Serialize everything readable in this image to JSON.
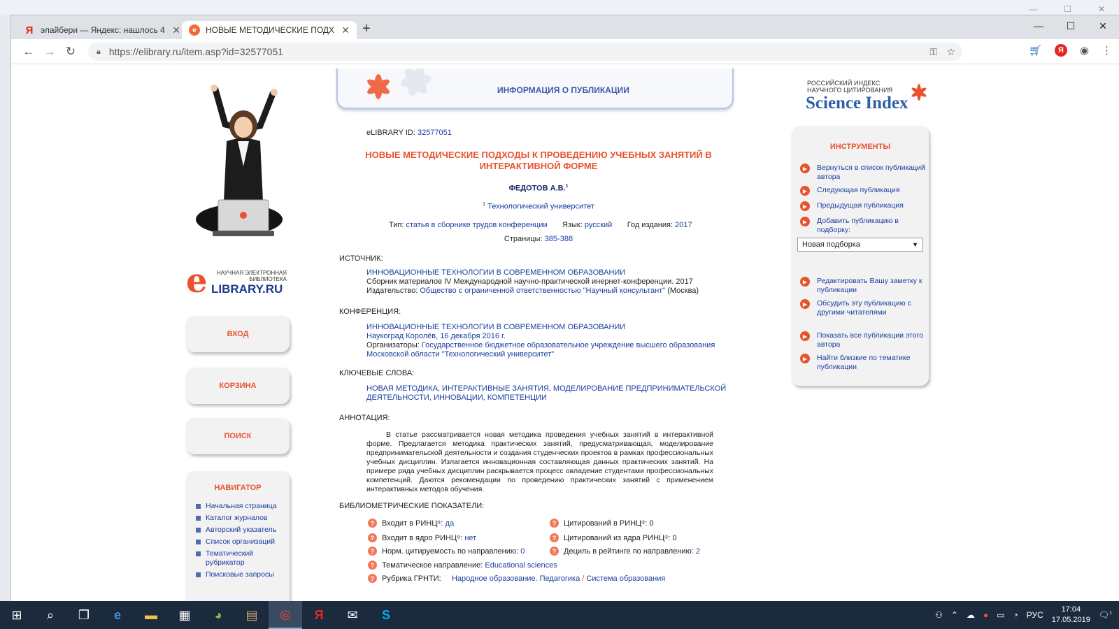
{
  "browser": {
    "tabs": [
      {
        "label": "элайбери — Яндекс: нашлось 4",
        "favicon": "yandex-icon"
      },
      {
        "label": "НОВЫЕ МЕТОДИЧЕСКИЕ ПОДХ",
        "favicon": "elibrary-icon"
      }
    ],
    "new_tab": "+",
    "url": "https://elibrary.ru/item.asp?id=32577051",
    "ya_ext": "Я",
    "yandex_fav": "Я",
    "elib_fav": "e"
  },
  "left": {
    "logo_small": "НАУЧНАЯ ЭЛЕКТРОННАЯ БИБЛИОТЕКА",
    "logo_e": "e",
    "logo_big": "LIBRARY.RU",
    "buttons": [
      "ВХОД",
      "КОРЗИНА",
      "ПОИСК"
    ],
    "navigator_title": "НАВИГАТОР",
    "navigator_items": [
      "Начальная страница",
      "Каталог журналов",
      "Авторский указатель",
      "Список организаций",
      "Тематический рубрикатор",
      "Поисковые запросы"
    ]
  },
  "center": {
    "banner_title": "ИНФОРМАЦИЯ О ПУБЛИКАЦИИ",
    "id_label": "eLIBRARY ID:",
    "id_value": "32577051",
    "title": "НОВЫЕ МЕТОДИЧЕСКИЕ ПОДХОДЫ К ПРОВЕДЕНИЮ УЧЕБНЫХ ЗАНЯТИЙ В ИНТЕРАКТИВНОЙ ФОРМЕ",
    "author": "ФЕДОТОВ А.В.",
    "author_sup": "1",
    "affil_sup": "1",
    "affiliation": "Технологический университет",
    "type_label": "Тип:",
    "type_value": "статья в сборнике трудов конференции",
    "lang_label": "Язык:",
    "lang_value": "русский",
    "year_label": "Год издания:",
    "year_value": "2017",
    "pages_label": "Страницы:",
    "pages_value": "385-388",
    "source_label": "ИСТОЧНИК:",
    "source_title": "ИННОВАЦИОННЫЕ ТЕХНОЛОГИИ В СОВРЕМЕННОМ ОБРАЗОВАНИИ",
    "source_desc": "Сборник материалов IV Международной научно-практической инернет-конференции. 2017",
    "publisher_label": "Издательство:",
    "publisher_value": "Общество с ограниченной ответственностью \"Научный консультант\"",
    "publisher_city": "(Москва)",
    "conf_label": "КОНФЕРЕНЦИЯ:",
    "conf_title": "ИННОВАЦИОННЫЕ ТЕХНОЛОГИИ В СОВРЕМЕННОМ ОБРАЗОВАНИИ",
    "conf_place": "Наукоград Королёв, 16 декабря 2016 г.",
    "organizers_label": "Организаторы:",
    "organizers_line1": "Государственное бюджетное образовательное учреждение высшего образования",
    "organizers_line2": "Московской области \"Технологический университет\"",
    "keywords_label": "КЛЮЧЕВЫЕ СЛОВА:",
    "keywords_line1": "НОВАЯ МЕТОДИКА, ИНТЕРАКТИВНЫЕ ЗАНЯТИЯ, МОДЕЛИРОВАНИЕ ПРЕДПРИНИМАТЕЛЬСКОЙ",
    "keywords_line2": "ДЕЯТЕЛЬНОСТИ, ИННОВАЦИИ, КОМПЕТЕНЦИИ",
    "abstract_label": "АННОТАЦИЯ:",
    "abstract": "В статье рассматривается новая методика проведения учебных занятий в интерактивной форме. Предлагается методика практических занятий, предусматривающая, моделирование предпринимательской деятельности и создания студенческих проектов в рамках профессиональных учебных дисциплин. Излагается инновационная составляющая данных практических занятий. На примере ряда учебных дисциплин раскрывается процесс овладение студентами профессиональных компетенций. Даются рекомендации по проведению практических занятий с применением интерактивных методов обучения.",
    "biblio_label": "БИБЛИОМЕТРИЧЕСКИЕ ПОКАЗАТЕЛИ:",
    "metrics_left": [
      {
        "label": "Входит в РИНЦ",
        "sup": "®",
        "sep": ":",
        "value": "да"
      },
      {
        "label": "Входит в ядро РИНЦ",
        "sup": "®",
        "sep": ":",
        "value": "нет"
      },
      {
        "label": "Норм. цитируемость по направлению:",
        "sup": "",
        "sep": "",
        "value": "0"
      }
    ],
    "metrics_right": [
      {
        "label": "Цитирований в РИНЦ",
        "sup": "®",
        "sep": ":",
        "value": "0"
      },
      {
        "label": "Цитирований из ядра РИНЦ",
        "sup": "®",
        "sep": ":",
        "value": "0"
      },
      {
        "label": "Дециль в рейтинге по направлению:",
        "sup": "",
        "sep": "",
        "value": "2"
      }
    ],
    "direction_label": "Тематическое направление:",
    "direction_value": "Educational sciences",
    "grnti_label": "Рубрика ГРНТИ:",
    "grnti_value1": "Народное образование. Педагогика",
    "grnti_sep": "/",
    "grnti_value2": "Система образования"
  },
  "right": {
    "si_small1": "РОССИЙСКИЙ ИНДЕКС",
    "si_small2": "НАУЧНОГО ЦИТИРОВАНИЯ",
    "si_big": "Science Index",
    "tools_title": "ИНСТРУМЕНТЫ",
    "tools": [
      "Вернуться в список публикаций автора",
      "Следующая публикация",
      "Предыдущая публикация",
      "Добавить публикацию в подборку:"
    ],
    "select_value": "Новая подборка",
    "tools2": [
      "Редактировать Вашу заметку к публикации",
      "Обсудить эту публикацию с другими читателями",
      "Показать все публикации этого автора",
      "Найти близкие по тематике публикации"
    ]
  },
  "taskbar": {
    "lang": "РУС",
    "time": "17:04",
    "date": "17.05.2019",
    "notif_count": "1"
  }
}
